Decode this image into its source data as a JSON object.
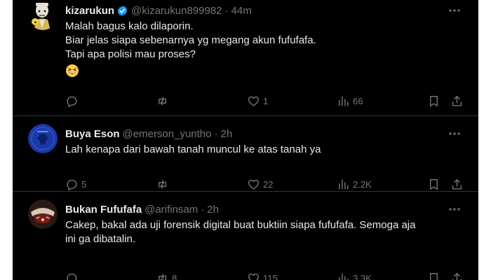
{
  "tweets": [
    {
      "name": "kizarukun",
      "verified": true,
      "handle": "@kizarukun899982",
      "time": "44m",
      "lines": [
        "Malah bagus kalo dilaporin.",
        "Biar jelas siapa sebenarnya yg megang akun fufufafa.",
        "Tapi apa polisi mau proses?"
      ],
      "emoji": "grinning-squinting-face",
      "reply_count": "",
      "retweet_count": "",
      "like_count": "1",
      "view_count": "66"
    },
    {
      "name": "Buya Eson",
      "verified": false,
      "handle": "@emerson_yuntho",
      "time": "2h",
      "lines": [
        "Lah kenapa dari bawah tanah muncul ke atas tanah ya"
      ],
      "reply_count": "5",
      "retweet_count": "",
      "like_count": "22",
      "view_count": "2.2K"
    },
    {
      "name": "Bukan Fufufafa",
      "verified": false,
      "handle": "@arifinsam",
      "time": "2h",
      "lines": [
        "Cakep, bakal ada uji forensik digital buat buktiin siapa fufufafa. Semoga aja",
        "ini ga dibatalin."
      ],
      "reply_count": "",
      "retweet_count": "8",
      "like_count": "115",
      "view_count": "3.3K"
    }
  ],
  "separator": "·",
  "colors": {
    "background": "#000000",
    "text": "#e7e9ea",
    "muted": "#71767b",
    "verified": "#1d9bf0",
    "divider": "#2f3336"
  }
}
